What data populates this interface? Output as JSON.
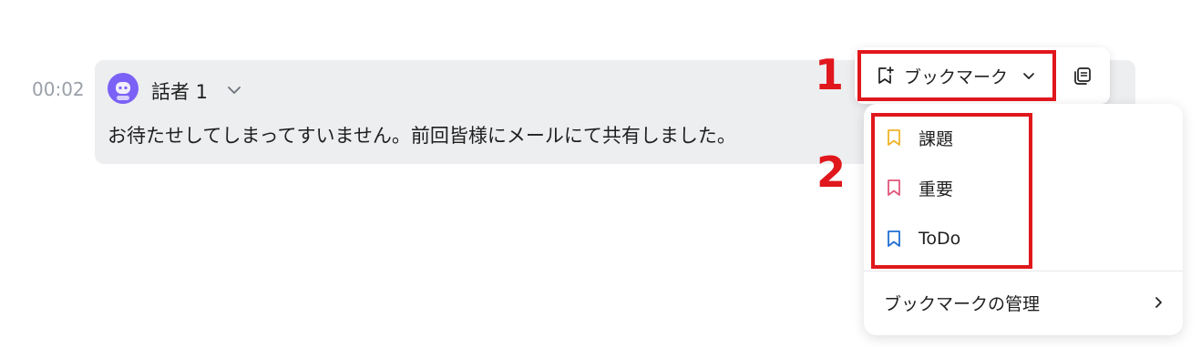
{
  "transcript": {
    "timestamp": "00:02",
    "speaker_name": "話者 1",
    "text": "お待たせしてしまってすいません。前回皆様にメールにて共有しました。",
    "card_color": "#edeef0",
    "avatar_color": "#7b61f5"
  },
  "toolbar": {
    "bookmark_label": "ブックマーク",
    "bookmark_icon": "bookmark-plus-icon",
    "dropdown_icon": "chevron-down-icon",
    "copy_icon": "copy-icon"
  },
  "annotations": {
    "step1": "1",
    "step2": "2",
    "color": "#e0171c"
  },
  "menu": {
    "items": [
      {
        "label": "課題",
        "icon": "bookmark-icon",
        "color": "#f0b429"
      },
      {
        "label": "重要",
        "icon": "bookmark-icon",
        "color": "#e0577a"
      },
      {
        "label": "ToDo",
        "icon": "bookmark-icon",
        "color": "#1f6fd1"
      }
    ],
    "manage_label": "ブックマークの管理",
    "manage_icon": "chevron-right-icon"
  }
}
